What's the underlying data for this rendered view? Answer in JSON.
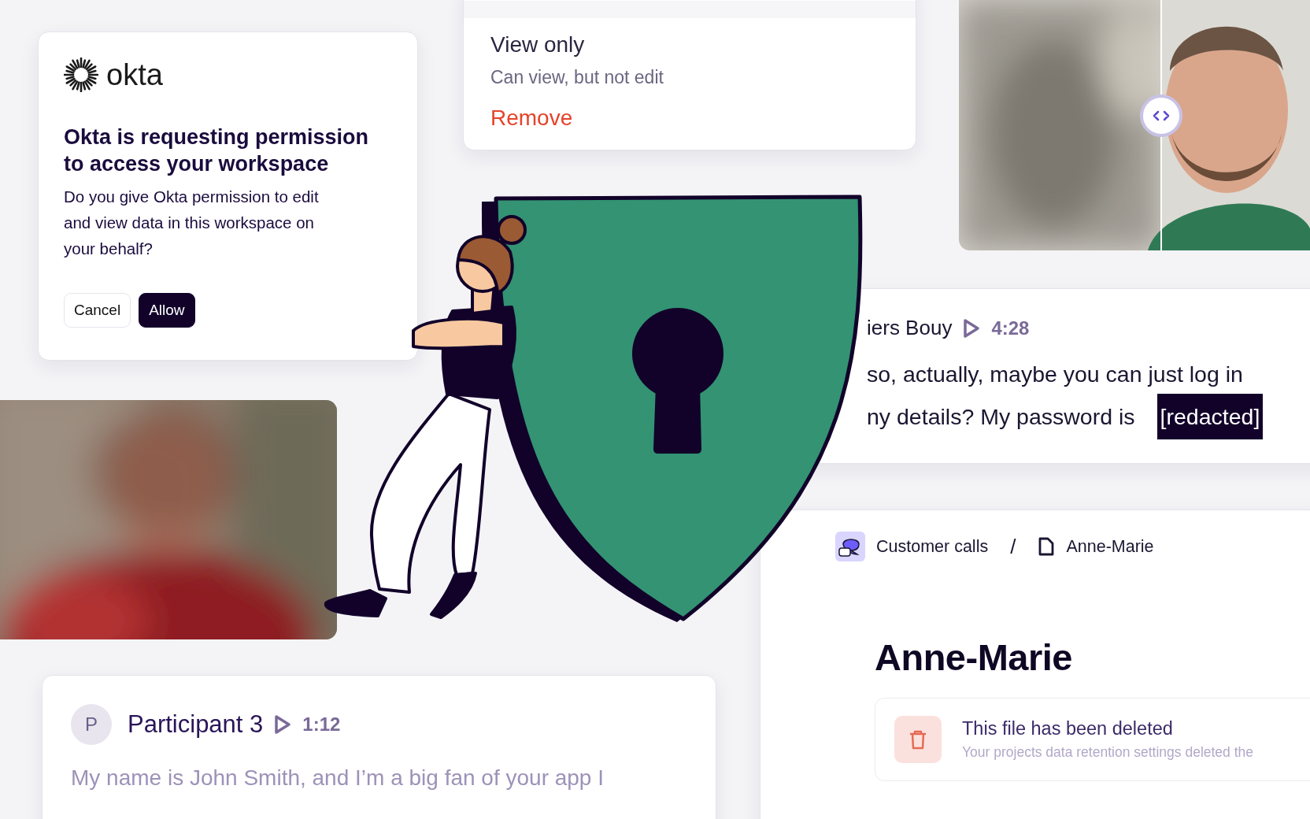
{
  "permission_menu": {
    "options": [
      {
        "title": "View only",
        "description": "Can view, but not edit"
      }
    ],
    "remove": "Remove"
  },
  "okta_dialog": {
    "brand": "okta",
    "title": "Okta is requesting permission to access your workspace",
    "message": "Do you give Okta permission to edit and view data in this workspace on your behalf?",
    "buttons": [
      {
        "label": "Cancel",
        "kind": "secondary"
      },
      {
        "label": "Allow",
        "kind": "primary"
      }
    ]
  },
  "transcript": {
    "speaker": "iers Bouy",
    "time": "4:28",
    "lines": [
      "so, actually, maybe you can just log in",
      "ny details? My password is"
    ],
    "redaction": "[redacted]"
  },
  "participant_card": {
    "avatar": "P",
    "speaker": "Participant 3",
    "time": "1:12",
    "text": "My name is John Smith, and I’m a big fan of your app I"
  },
  "document": {
    "breadcrumb": [
      "Customer calls",
      "Anne-Marie"
    ],
    "separator": "/",
    "title": "Anne-Marie",
    "notice": {
      "title": "This file has been deleted",
      "description": "Your projects data retention settings deleted the"
    }
  }
}
